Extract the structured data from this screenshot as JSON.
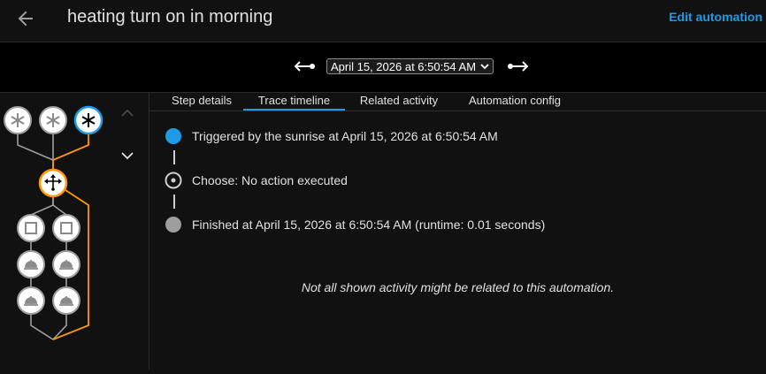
{
  "header": {
    "back_icon": "arrow-left-icon",
    "title": "heating turn on in morning",
    "edit_label": "Edit automation",
    "accent_color": "#1e9be6"
  },
  "trace_nav": {
    "prev_icon": "arrow-left-end-icon",
    "next_icon": "arrow-right-end-icon",
    "selected_run": "April 15, 2026 at 6:50:54 AM"
  },
  "graph": {
    "trigger_icon": "asterisk-icon",
    "choose_icon": "arrows-split-icon",
    "condition_icon": "square-icon",
    "action_icon": "service-bell-icon",
    "up_icon": "chevron-up-icon",
    "down_icon": "chevron-down-icon",
    "active_trace_color": "#ff9800",
    "selected_node_color": "#1e9be6"
  },
  "tabs": [
    {
      "label": "Step details"
    },
    {
      "label": "Trace timeline"
    },
    {
      "label": "Related activity"
    },
    {
      "label": "Automation config"
    }
  ],
  "active_tab": "Trace timeline",
  "timeline": [
    {
      "text": "Triggered by the sunrise at April 15, 2026 at 6:50:54 AM",
      "marker": "filled-blue-circle"
    },
    {
      "text": "Choose: No action executed",
      "marker": "ring-dot-circle"
    },
    {
      "text": "Finished at April 15, 2026 at 6:50:54 AM (runtime: 0.01 seconds)",
      "marker": "filled-gray-circle"
    }
  ],
  "note": "Not all shown activity might be related to this automation."
}
